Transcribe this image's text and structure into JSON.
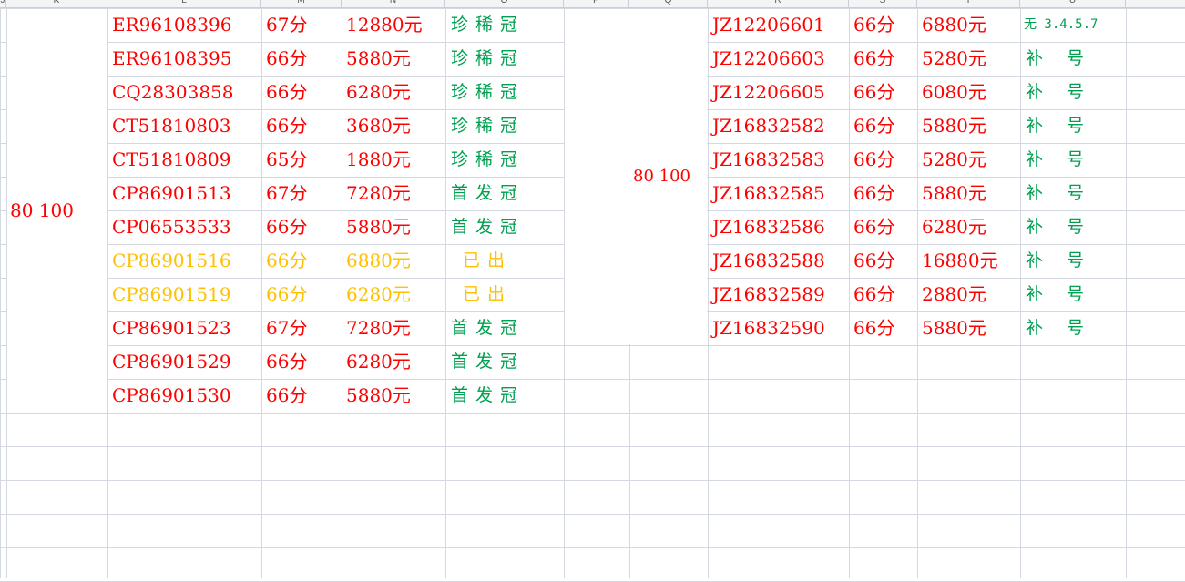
{
  "columns": [
    "J",
    "K",
    "L",
    "M",
    "N",
    "O",
    "P",
    "Q",
    "R",
    "S",
    "T",
    "U"
  ],
  "left_block": {
    "merged_label": "80 100",
    "rows": [
      {
        "code": "ER96108396",
        "score": "67分",
        "price": "12880元",
        "status": "珍稀冠",
        "color": "red"
      },
      {
        "code": "ER96108395",
        "score": "66分",
        "price": "5880元",
        "status": "珍稀冠",
        "color": "red"
      },
      {
        "code": "CQ28303858",
        "score": "66分",
        "price": "6280元",
        "status": "珍稀冠",
        "color": "red"
      },
      {
        "code": "CT51810803",
        "score": "66分",
        "price": "3680元",
        "status": "珍稀冠",
        "color": "red"
      },
      {
        "code": "CT51810809",
        "score": "65分",
        "price": "1880元",
        "status": "珍稀冠",
        "color": "red"
      },
      {
        "code": "CP86901513",
        "score": "67分",
        "price": "7280元",
        "status": "首发冠",
        "color": "red"
      },
      {
        "code": "CP06553533",
        "score": "66分",
        "price": "5880元",
        "status": "首发冠",
        "color": "red"
      },
      {
        "code": "CP86901516",
        "score": "66分",
        "price": "6880元",
        "status": "已出",
        "color": "yellow"
      },
      {
        "code": "CP86901519",
        "score": "66分",
        "price": "6280元",
        "status": "已出",
        "color": "yellow"
      },
      {
        "code": "CP86901523",
        "score": "67分",
        "price": "7280元",
        "status": "首发冠",
        "color": "red"
      },
      {
        "code": "CP86901529",
        "score": "66分",
        "price": "6280元",
        "status": "首发冠",
        "color": "red"
      },
      {
        "code": "CP86901530",
        "score": "66分",
        "price": "5880元",
        "status": "首发冠",
        "color": "red"
      }
    ]
  },
  "right_block": {
    "merged_label": "80 100",
    "rows": [
      {
        "code": "JZ12206601",
        "score": "66分",
        "price": "6880元",
        "status": "无 3.4.5.7",
        "small": true
      },
      {
        "code": "JZ12206603",
        "score": "66分",
        "price": "5280元",
        "status": "补号"
      },
      {
        "code": "JZ12206605",
        "score": "66分",
        "price": "6080元",
        "status": "补号"
      },
      {
        "code": "JZ16832582",
        "score": "66分",
        "price": "5880元",
        "status": "补号"
      },
      {
        "code": "JZ16832583",
        "score": "66分",
        "price": "5280元",
        "status": "补号"
      },
      {
        "code": "JZ16832585",
        "score": "66分",
        "price": "5880元",
        "status": "补号"
      },
      {
        "code": "JZ16832586",
        "score": "66分",
        "price": "6280元",
        "status": "补号"
      },
      {
        "code": "JZ16832588",
        "score": "66分",
        "price": "16880元",
        "status": "补号"
      },
      {
        "code": "JZ16832589",
        "score": "66分",
        "price": "2880元",
        "status": "补号"
      },
      {
        "code": "JZ16832590",
        "score": "66分",
        "price": "5880元",
        "status": "补号"
      }
    ]
  },
  "colors": {
    "red": "#ff0000",
    "yellow": "#ffc000",
    "green": "#00a050",
    "grid": "#d4d8e0"
  }
}
